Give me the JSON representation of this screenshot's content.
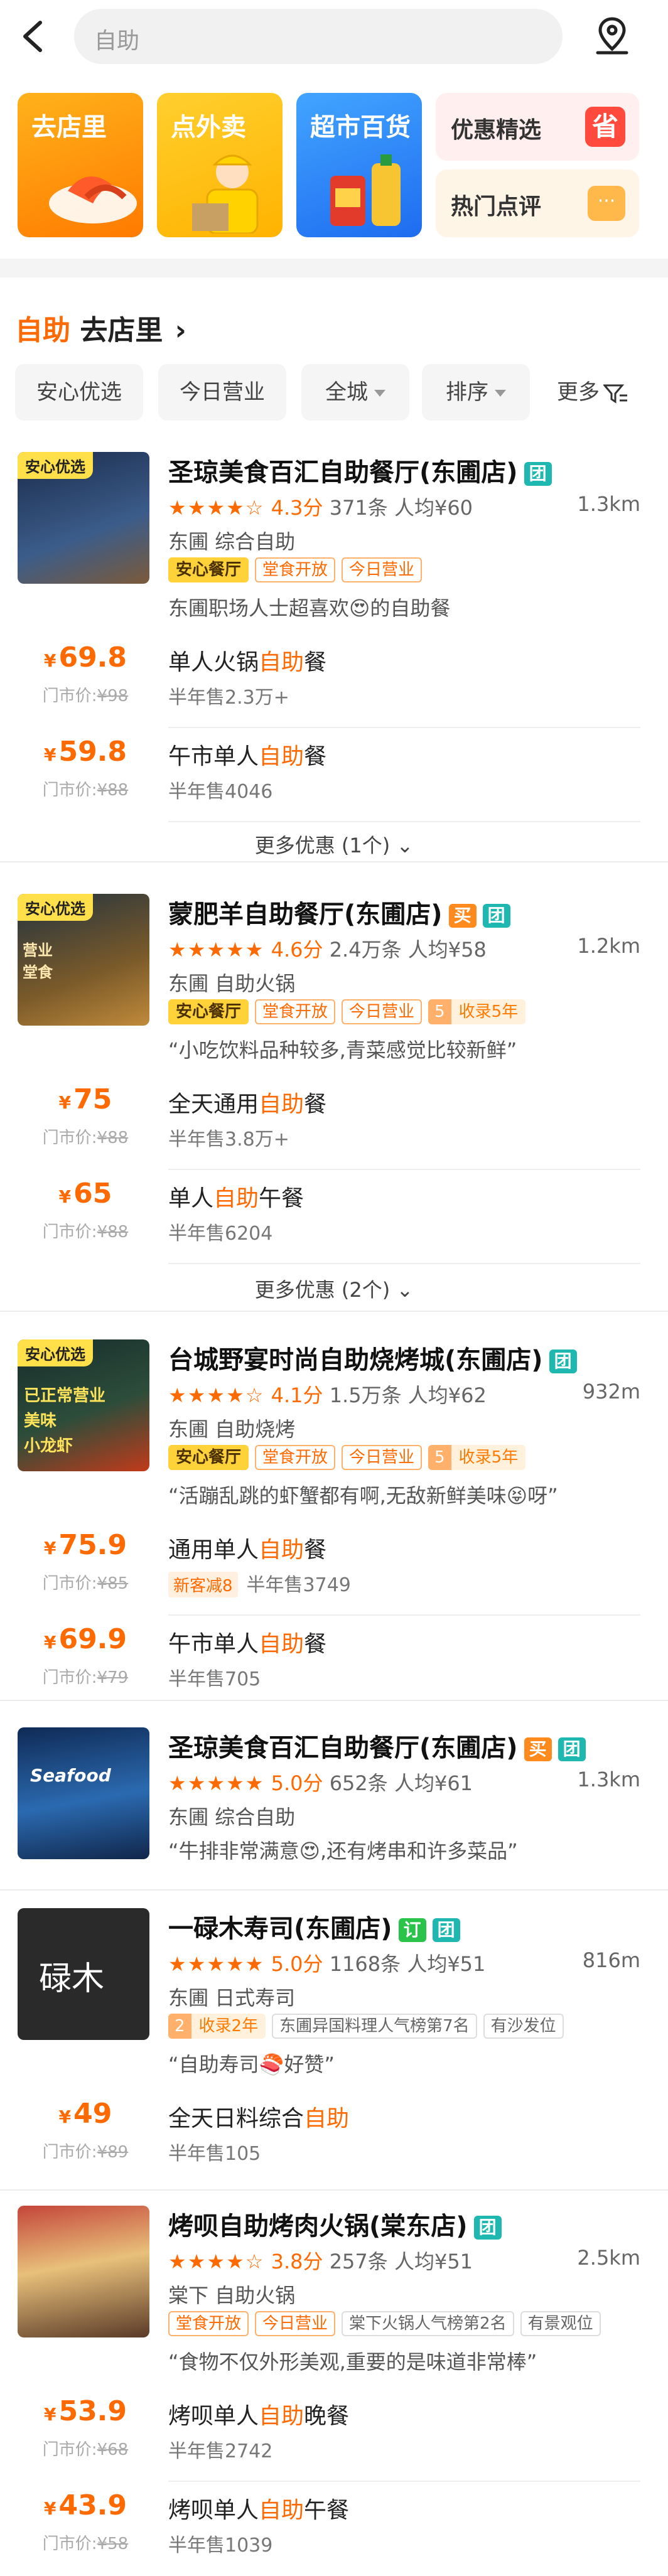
{
  "search": {
    "placeholder": "自助"
  },
  "categories": [
    {
      "label": "去店里"
    },
    {
      "label": "点外卖"
    },
    {
      "label": "超市百货"
    },
    {
      "label": "优惠精选",
      "icon_text": "省"
    },
    {
      "label": "热门点评",
      "icon_text": "···"
    }
  ],
  "section": {
    "keyword": "自助",
    "title": "去店里",
    "arrow": "›"
  },
  "filters": [
    "安心优选",
    "今日营业",
    "全城",
    "排序",
    "更多"
  ],
  "shops": [
    {
      "name": "圣琼美食百汇自助餐厅(东圃店)",
      "tags": [
        "团"
      ],
      "stars": "★★★★☆",
      "score": "4.3分",
      "reviews": "371条",
      "avg": "人均¥60",
      "distance": "1.3km",
      "area": "东圃  综合自助",
      "badge": "安心优选",
      "pills": [
        "安心餐厅",
        "堂食开放",
        "今日营业"
      ],
      "quote": "东圃职场人士超喜欢😍的自助餐",
      "deals": [
        {
          "price": "69.8",
          "market": "¥98",
          "name_pre": "单人火锅",
          "name_hl": "自助",
          "name_post": "餐",
          "sold": "半年售2.3万+"
        },
        {
          "price": "59.8",
          "market": "¥88",
          "name_pre": "午市单人",
          "name_hl": "自助",
          "name_post": "餐",
          "sold": "半年售4046"
        }
      ],
      "more": "更多优惠 (1个)"
    },
    {
      "name": "蒙肥羊自助餐厅(东圃店)",
      "tags": [
        "买",
        "团"
      ],
      "stars": "★★★★★",
      "score": "4.6分",
      "reviews": "2.4万条",
      "avg": "人均¥58",
      "distance": "1.2km",
      "area": "东圃  自助火锅",
      "badge": "安心优选",
      "thumb_text": "营业\n堂食",
      "pills": [
        "安心餐厅",
        "堂食开放",
        "今日营业"
      ],
      "num_pill": "5",
      "rank_pill": "收录5年",
      "quote": "“小吃饮料品种较多,青菜感觉比较新鲜”",
      "deals": [
        {
          "price": "75",
          "market": "¥88",
          "name_pre": "全天通用",
          "name_hl": "自助",
          "name_post": "餐",
          "sold": "半年售3.8万+"
        },
        {
          "price": "65",
          "market": "¥88",
          "name_pre": "单人",
          "name_hl": "自助",
          "name_post": "午餐",
          "sold": "半年售6204"
        }
      ],
      "more": "更多优惠 (2个)"
    },
    {
      "name": "台城野宴时尚自助烧烤城(东圃店)",
      "tags": [
        "团"
      ],
      "stars": "★★★★☆",
      "score": "4.1分",
      "reviews": "1.5万条",
      "avg": "人均¥62",
      "distance": "932m",
      "area": "东圃  自助烧烤",
      "badge": "安心优选",
      "thumb_text": "已正常营业\n美味\n小龙虾",
      "pills": [
        "安心餐厅",
        "堂食开放",
        "今日营业"
      ],
      "num_pill": "5",
      "rank_pill": "收录5年",
      "quote": "“活蹦乱跳的虾蟹都有啊,无敌新鲜美味😝呀”",
      "deals": [
        {
          "price": "75.9",
          "market": "¥85",
          "name_pre": "通用单人",
          "name_hl": "自助",
          "name_post": "餐",
          "newcut": "新客减8",
          "sold": "半年售3749"
        },
        {
          "price": "69.9",
          "market": "¥79",
          "name_pre": "午市单人",
          "name_hl": "自助",
          "name_post": "餐",
          "sold": "半年售705"
        }
      ]
    },
    {
      "name": "圣琼美食百汇自助餐厅(东圃店)",
      "tags": [
        "买",
        "团"
      ],
      "stars": "★★★★★",
      "score": "5.0分",
      "reviews": "652条",
      "avg": "人均¥61",
      "distance": "1.3km",
      "area": "东圃  综合自助",
      "thumb_text": "Seafood",
      "quote": "“牛排非常满意😍,还有烤串和许多菜品”"
    },
    {
      "name": "一碌木寿司(东圃店)",
      "tags": [
        "订",
        "团"
      ],
      "stars": "★★★★★",
      "score": "5.0分",
      "reviews": "1168条",
      "avg": "人均¥51",
      "distance": "816m",
      "area": "东圃  日式寿司",
      "thumb_text": "碌木",
      "num_pill": "2",
      "rank_pill": "收录2年",
      "gray_pills": [
        "东圃异国料理人气榜第7名",
        "有沙发位"
      ],
      "quote": "“自助寿司🍣好赞”",
      "deals": [
        {
          "price": "49",
          "market": "¥89",
          "name_pre": "全天日料综合",
          "name_hl": "自助",
          "name_post": "",
          "sold": "半年售105"
        }
      ]
    },
    {
      "name": "烤呗自助烤肉火锅(棠东店)",
      "tags": [
        "团"
      ],
      "stars": "★★★★☆",
      "score": "3.8分",
      "reviews": "257条",
      "avg": "人均¥51",
      "distance": "2.5km",
      "area": "棠下  自助火锅",
      "pills": [
        "堂食开放",
        "今日营业"
      ],
      "gray_pills": [
        "棠下火锅人气榜第2名",
        "有景观位"
      ],
      "quote": "“食物不仅外形美观,重要的是味道非常棒”",
      "deals": [
        {
          "price": "53.9",
          "market": "¥68",
          "name_pre": "烤呗单人",
          "name_hl": "自助",
          "name_post": "晚餐",
          "sold": "半年售2742"
        },
        {
          "price": "43.9",
          "market": "¥58",
          "name_pre": "烤呗单人",
          "name_hl": "自助",
          "name_post": "午餐",
          "sold": "半年售1039"
        }
      ]
    }
  ],
  "labels": {
    "market_prefix": "门市价:",
    "currency": "¥"
  },
  "colors": {
    "accent": "#ff6a00",
    "group_tag": "#1fb8b0",
    "buy_tag": "#ff8a1e",
    "book_tag": "#2bc44a"
  }
}
